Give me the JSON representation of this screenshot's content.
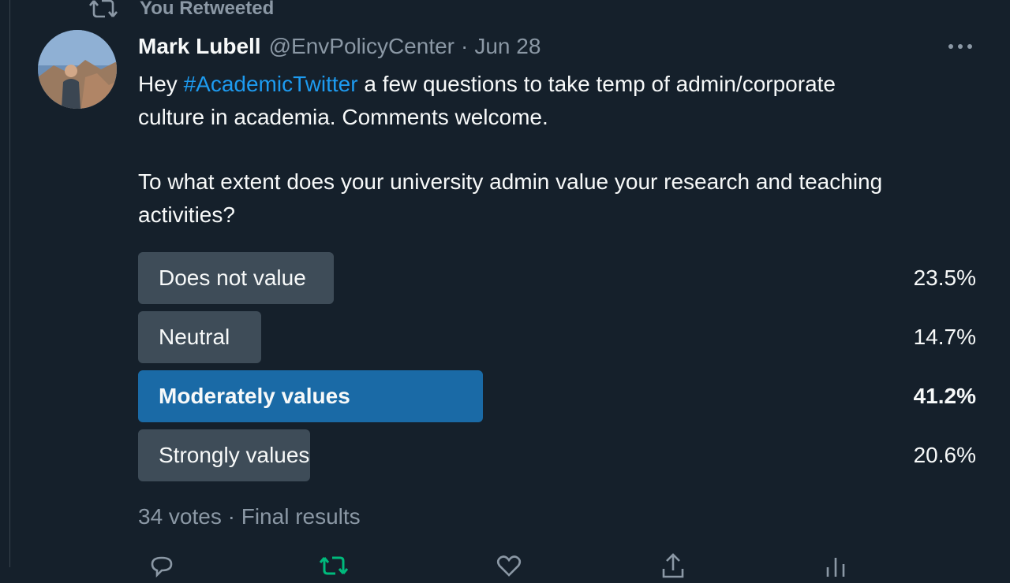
{
  "retweet": {
    "label": "You Retweeted",
    "icon": "retweet-icon"
  },
  "author": {
    "name": "Mark Lubell",
    "handle": "@EnvPolicyCenter",
    "separator": "·",
    "date": "Jun 28"
  },
  "tweet": {
    "text_prefix": "Hey ",
    "hashtag": "#AcademicTwitter",
    "text_line1_rest": " a few questions to take temp of admin/corporate",
    "text_line2": "culture in academia.  Comments welcome.",
    "question_line1": "To what extent does your university admin value your research and teaching",
    "question_line2": "activities?"
  },
  "poll": {
    "options": [
      {
        "label": "Does not value",
        "percent_text": "23.5%",
        "value": 23.5
      },
      {
        "label": "Neutral",
        "percent_text": "14.7%",
        "value": 14.7
      },
      {
        "label": "Moderately values",
        "percent_text": "41.2%",
        "value": 41.2,
        "winner": true
      },
      {
        "label": "Strongly values",
        "percent_text": "20.6%",
        "value": 20.6
      }
    ],
    "footer": "34 votes · Final results"
  },
  "colors": {
    "background": "#15202b",
    "link": "#1d9bf0",
    "winner_bar": "#1a6aa6",
    "bar": "#3e4c58",
    "muted": "#8b98a5",
    "retweet_green": "#00ba7c"
  },
  "icons": [
    "more-icon",
    "reply-icon",
    "retweet-action-icon",
    "like-icon",
    "share-icon",
    "analytics-icon"
  ]
}
